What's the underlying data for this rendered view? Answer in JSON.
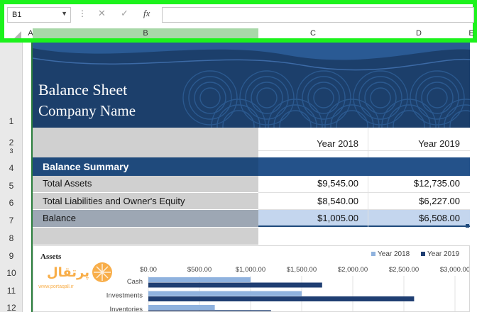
{
  "formula_bar": {
    "name_box": "B1",
    "cancel_glyph": "✕",
    "enter_glyph": "✓",
    "fx_glyph": "fx",
    "formula_value": ""
  },
  "columns": [
    "A",
    "B",
    "C",
    "D",
    "E"
  ],
  "rows": [
    "1",
    "2",
    "3",
    "4",
    "5",
    "6",
    "7",
    "8",
    "9",
    "10",
    "11",
    "12"
  ],
  "banner": {
    "title": "Balance Sheet",
    "subtitle": "Company Name"
  },
  "years": [
    "Year 2018",
    "Year 2019"
  ],
  "summary": {
    "title": "Balance Summary",
    "rows": [
      {
        "label": "Total Assets",
        "y2018": "$9,545.00",
        "y2019": "$12,735.00"
      },
      {
        "label": "Total Liabilities and Owner's Equity",
        "y2018": "$8,540.00",
        "y2019": "$6,227.00"
      },
      {
        "label": "Balance",
        "y2018": "$1,005.00",
        "y2019": "$6,508.00"
      }
    ]
  },
  "chart_data": {
    "type": "bar",
    "orientation": "horizontal",
    "title": "Assets",
    "legend_position": "top-right",
    "x_tick_labels": [
      "$0.00",
      "$500.00",
      "$1,000.00",
      "$1,500.00",
      "$2,000.00",
      "$2,500.00",
      "$3,000.00"
    ],
    "xlim": [
      0,
      3000
    ],
    "categories": [
      "Cash",
      "Investments",
      "Inventories"
    ],
    "series": [
      {
        "name": "Year 2018",
        "color": "#8fb2de",
        "values": [
          1000,
          1500,
          650
        ]
      },
      {
        "name": "Year 2019",
        "color": "#1f3e72",
        "values": [
          1700,
          2600,
          1200
        ]
      }
    ]
  },
  "colors": {
    "selection_frame": "#1cf21c",
    "banner": "#1c3f6b",
    "summary_header": "#1f4a7c",
    "balance_row": "#c4d6ee"
  },
  "watermark": {
    "brand": "پرتقال",
    "url": "www.portaqall.ir"
  }
}
